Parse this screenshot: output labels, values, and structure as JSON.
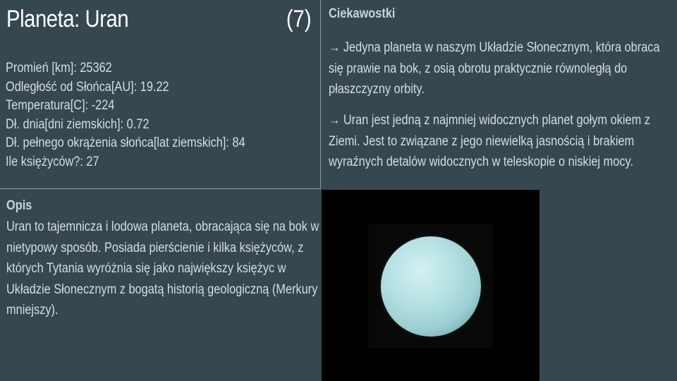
{
  "header": {
    "title": "Planeta: Uran",
    "slide_number": "(7)"
  },
  "stats": [
    "Promień [km]: 25362",
    "Odległość od Słońca[AU]: 19.22",
    "Temperatura[C]: -224",
    "Dł. dnia[dni ziemskich]: 0.72",
    "Dł. pełnego okrążenia słońca[lat ziemskich]: 84",
    "Ile księżyców?: 27"
  ],
  "fun_facts": {
    "heading": "Ciekawostki",
    "items": [
      "→ Jedyna planeta w naszym Układzie Słonecznym, która obraca się prawie na bok, z osią obrotu praktycznie równoległą do płaszczyzny orbity.",
      "→ Uran jest jedną z najmniej widocznych planet gołym okiem z Ziemi. Jest to związane z jego niewielką jasnością i brakiem wyraźnych detalów widocznych w teleskopie o niskiej mocy."
    ]
  },
  "description": {
    "heading": "Opis",
    "text": "Uran to tajemnicza i lodowa planeta, obracająca się na bok w nietypowy sposób. Posiada pierścienie i kilka księżyców, z których Tytania wyróżnia się jako największy księżyc w Układzie Słonecznym z bogatą historią geologiczną (Merkury mniejszy)."
  },
  "image": {
    "subject": "uranus-planet-photo"
  },
  "colors": {
    "background": "#37474f",
    "divider": "#8a979d",
    "planet": "#b7e2e4"
  }
}
